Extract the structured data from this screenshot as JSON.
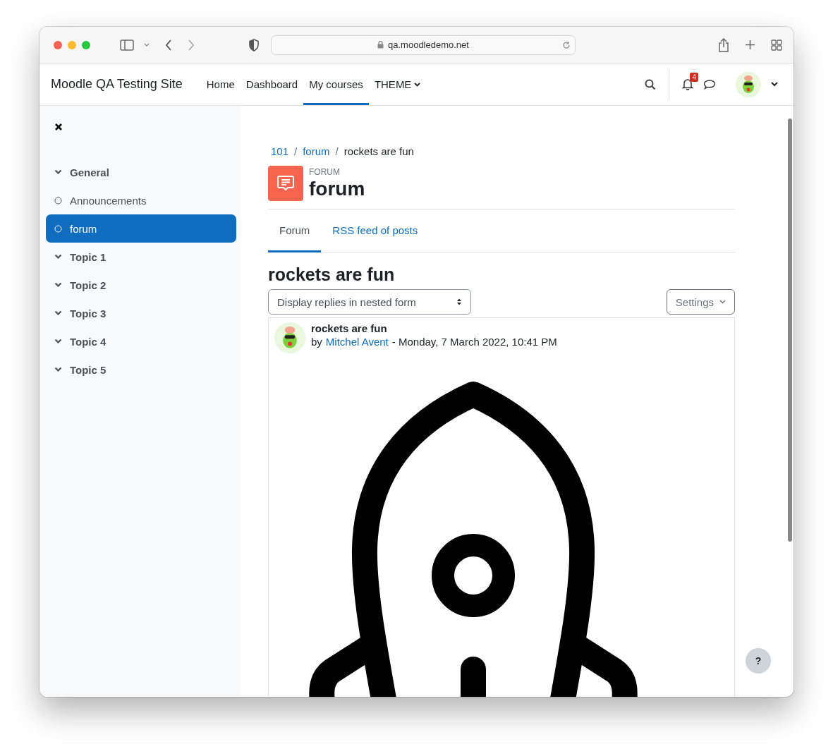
{
  "browser": {
    "url": "qa.moodledemo.net"
  },
  "navbar": {
    "site_name": "Moodle QA Testing Site",
    "items": [
      {
        "label": "Home",
        "selected": false,
        "dropdown": false
      },
      {
        "label": "Dashboard",
        "selected": false,
        "dropdown": false
      },
      {
        "label": "My courses",
        "selected": true,
        "dropdown": false
      },
      {
        "label": "THEME",
        "selected": false,
        "dropdown": true
      }
    ],
    "notification_count": "4"
  },
  "sidebar": {
    "items": [
      {
        "kind": "section",
        "label": "General",
        "expanded": true,
        "selected": false
      },
      {
        "kind": "activity",
        "label": "Announcements",
        "selected": false
      },
      {
        "kind": "activity",
        "label": "forum",
        "selected": true
      },
      {
        "kind": "section",
        "label": "Topic 1",
        "expanded": true,
        "selected": false
      },
      {
        "kind": "section",
        "label": "Topic 2",
        "expanded": true,
        "selected": false
      },
      {
        "kind": "section",
        "label": "Topic 3",
        "expanded": true,
        "selected": false
      },
      {
        "kind": "section",
        "label": "Topic 4",
        "expanded": true,
        "selected": false
      },
      {
        "kind": "section",
        "label": "Topic 5",
        "expanded": true,
        "selected": false
      }
    ]
  },
  "breadcrumb": [
    {
      "label": "101",
      "link": true
    },
    {
      "separator": "/",
      "label": "forum",
      "link": true
    },
    {
      "separator": "/",
      "label": "rockets are fun",
      "link": false
    }
  ],
  "header": {
    "type_label": "FORUM",
    "title": "forum"
  },
  "tabs": [
    {
      "label": "Forum",
      "selected": true
    },
    {
      "label": "RSS feed of posts",
      "selected": false
    }
  ],
  "discussion": {
    "title": "rockets are fun",
    "display_mode": "Display replies in nested form",
    "settings_label": "Settings",
    "post": {
      "subject": "rockets are fun",
      "by": "by",
      "author": "Mitchel Avent",
      "date": "- Monday, 7 March 2022, 10:41 PM"
    }
  },
  "help_button": "?"
}
